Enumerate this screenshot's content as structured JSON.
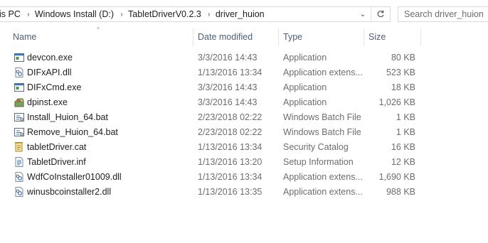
{
  "address": {
    "crumbs": [
      "is PC",
      "Windows Install (D:)",
      "TabletDriverV0.2.3",
      "driver_huion"
    ],
    "dropdown_glyph": "⌄",
    "refresh_icon": "refresh-icon"
  },
  "search": {
    "placeholder": "Search driver_huion"
  },
  "columns": {
    "name": "Name",
    "date": "Date modified",
    "type": "Type",
    "size": "Size",
    "sort_glyph": "^"
  },
  "files": [
    {
      "name": "devcon.exe",
      "date": "3/3/2016 14:43",
      "type": "Application",
      "size": "80 KB",
      "icon": "app"
    },
    {
      "name": "DIFxAPI.dll",
      "date": "1/13/2016 13:34",
      "type": "Application extens...",
      "size": "523 KB",
      "icon": "dll"
    },
    {
      "name": "DIFxCmd.exe",
      "date": "3/3/2016 14:43",
      "type": "Application",
      "size": "18 KB",
      "icon": "app"
    },
    {
      "name": "dpinst.exe",
      "date": "3/3/2016 14:43",
      "type": "Application",
      "size": "1,026 KB",
      "icon": "installer"
    },
    {
      "name": "Install_Huion_64.bat",
      "date": "2/23/2018 02:22",
      "type": "Windows Batch File",
      "size": "1 KB",
      "icon": "bat"
    },
    {
      "name": "Remove_Huion_64.bat",
      "date": "2/23/2018 02:22",
      "type": "Windows Batch File",
      "size": "1 KB",
      "icon": "bat"
    },
    {
      "name": "tabletDriver.cat",
      "date": "1/13/2016 13:34",
      "type": "Security Catalog",
      "size": "16 KB",
      "icon": "cat"
    },
    {
      "name": "TabletDriver.inf",
      "date": "1/13/2016 13:20",
      "type": "Setup Information",
      "size": "12 KB",
      "icon": "inf"
    },
    {
      "name": "WdfCoInstaller01009.dll",
      "date": "1/13/2016 13:34",
      "type": "Application extens...",
      "size": "1,690 KB",
      "icon": "dll"
    },
    {
      "name": "winusbcoinstaller2.dll",
      "date": "1/13/2016 13:35",
      "type": "Application extens...",
      "size": "988 KB",
      "icon": "dll"
    }
  ]
}
